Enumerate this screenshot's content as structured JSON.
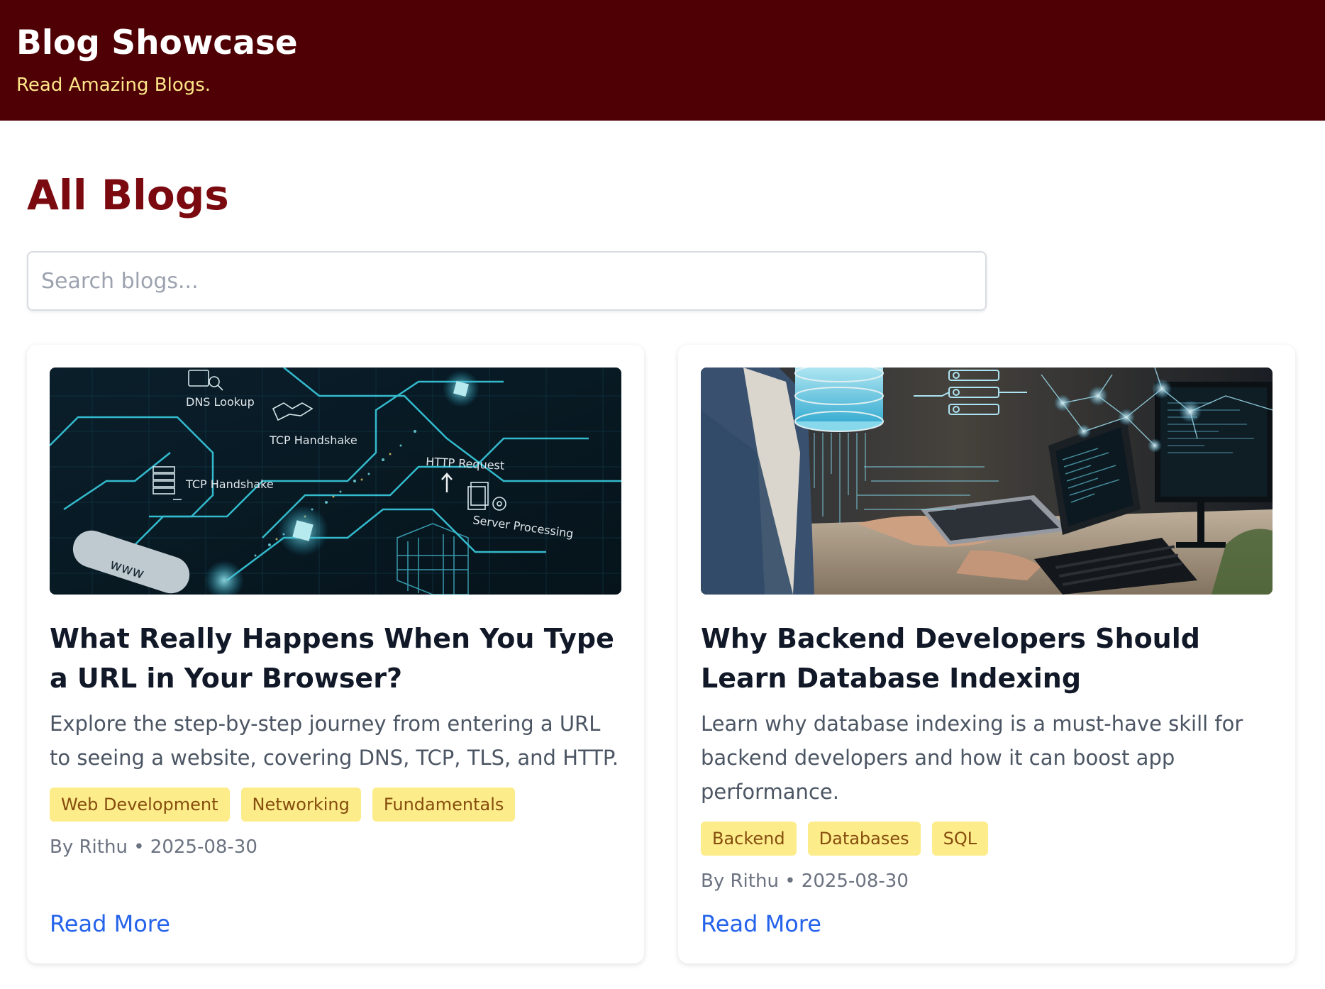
{
  "header": {
    "title": "Blog Showcase",
    "tagline": "Read Amazing Blogs."
  },
  "main": {
    "heading": "All Blogs",
    "search": {
      "placeholder": "Search blogs...",
      "value": ""
    }
  },
  "posts": [
    {
      "title": "What Really Happens When You Type a URL in Your Browser?",
      "excerpt": "Explore the step-by-step journey from entering a URL to seeing a website, covering DNS, TCP, TLS, and HTTP.",
      "tags": [
        "Web Development",
        "Networking",
        "Fundamentals"
      ],
      "byline": "By Rithu • 2025-08-30",
      "read_more": "Read More",
      "image_labels": {
        "dns": "DNS Lookup",
        "tcp1": "TCP Handshake",
        "tcp2": "TCP Handshake",
        "http": "HTTP Request",
        "server": "Server Processing",
        "www": "www"
      }
    },
    {
      "title": "Why Backend Developers Should Learn Database Indexing",
      "excerpt": "Learn why database indexing is a must-have skill for backend developers and how it can boost app performance.",
      "tags": [
        "Backend",
        "Databases",
        "SQL"
      ],
      "byline": "By Rithu • 2025-08-30",
      "read_more": "Read More"
    }
  ],
  "colors": {
    "header_bg": "#4f0004",
    "tagline": "#fde68a",
    "heading": "#7a0a10",
    "tag_bg": "#fdec8a",
    "tag_text": "#854d0e",
    "link": "#2563eb"
  }
}
